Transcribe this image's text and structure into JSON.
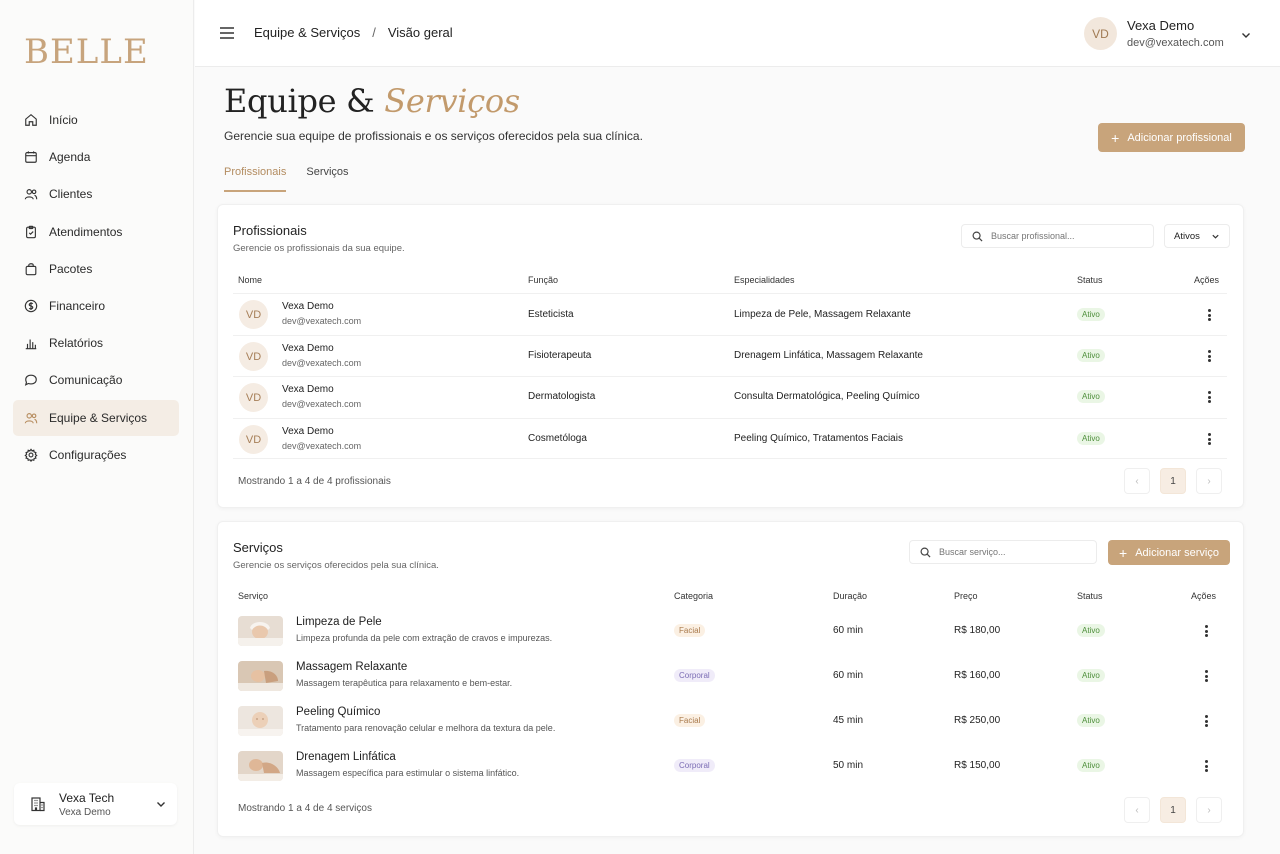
{
  "sidebar": {
    "logo": "BELLE",
    "items": [
      {
        "label": "Início",
        "icon": "home-icon"
      },
      {
        "label": "Agenda",
        "icon": "calendar-icon"
      },
      {
        "label": "Clientes",
        "icon": "users-icon"
      },
      {
        "label": "Atendimentos",
        "icon": "clipboard-icon"
      },
      {
        "label": "Pacotes",
        "icon": "bag-icon"
      },
      {
        "label": "Financeiro",
        "icon": "dollar-icon"
      },
      {
        "label": "Relatórios",
        "icon": "bar-chart-icon"
      },
      {
        "label": "Comunicação",
        "icon": "chat-icon"
      },
      {
        "label": "Equipe & Serviços",
        "icon": "team-icon",
        "active": true
      },
      {
        "label": "Configurações",
        "icon": "gear-icon"
      }
    ],
    "org": {
      "name": "Vexa Tech",
      "sub": "Vexa Demo"
    }
  },
  "header": {
    "crumb1": "Equipe & Serviços",
    "separator": "/",
    "crumb2": "Visão geral",
    "user": {
      "initials": "VD",
      "name": "Vexa Demo",
      "email": "dev@vexatech.com"
    }
  },
  "page": {
    "title_main": "Equipe &",
    "title_accent": "Serviços",
    "subtitle": "Gerencie sua equipe de profissionais e os serviços oferecidos pela sua clínica.",
    "add_professional": "Adicionar profissional",
    "tabs": [
      "Profissionais",
      "Serviços"
    ]
  },
  "professionals": {
    "title": "Profissionais",
    "subtitle": "Gerencie os profissionais da sua equipe.",
    "search_placeholder": "Buscar profissional...",
    "filter": "Ativos",
    "columns": {
      "name": "Nome",
      "role": "Função",
      "specialties": "Especialidades",
      "status": "Status",
      "actions": "Ações"
    },
    "rows": [
      {
        "initials": "VD",
        "name": "Vexa Demo",
        "email": "dev@vexatech.com",
        "role": "Esteticista",
        "specialties": "Limpeza de Pele, Massagem Relaxante",
        "status": "Ativo"
      },
      {
        "initials": "VD",
        "name": "Vexa Demo",
        "email": "dev@vexatech.com",
        "role": "Fisioterapeuta",
        "specialties": "Drenagem Linfática, Massagem Relaxante",
        "status": "Ativo"
      },
      {
        "initials": "VD",
        "name": "Vexa Demo",
        "email": "dev@vexatech.com",
        "role": "Dermatologista",
        "specialties": "Consulta Dermatológica, Peeling Químico",
        "status": "Ativo"
      },
      {
        "initials": "VD",
        "name": "Vexa Demo",
        "email": "dev@vexatech.com",
        "role": "Cosmetóloga",
        "specialties": "Peeling Químico, Tratamentos Faciais",
        "status": "Ativo"
      }
    ],
    "footer": "Mostrando 1 a 4 de 4 profissionais",
    "page": "1",
    "prev": "‹",
    "next": "›"
  },
  "services": {
    "title": "Serviços",
    "subtitle": "Gerencie os serviços oferecidos pela sua clínica.",
    "search_placeholder": "Buscar serviço...",
    "add": "Adicionar serviço",
    "columns": {
      "service": "Serviço",
      "category": "Categoria",
      "duration": "Duração",
      "price": "Preço",
      "status": "Status",
      "actions": "Ações"
    },
    "rows": [
      {
        "name": "Limpeza de Pele",
        "desc": "Limpeza profunda da pele com extração de cravos e impurezas.",
        "category": "Facial",
        "duration": "60 min",
        "price": "R$ 180,00",
        "status": "Ativo"
      },
      {
        "name": "Massagem Relaxante",
        "desc": "Massagem terapêutica para relaxamento e bem-estar.",
        "category": "Corporal",
        "duration": "60 min",
        "price": "R$ 160,00",
        "status": "Ativo"
      },
      {
        "name": "Peeling Químico",
        "desc": "Tratamento para renovação celular e melhora da textura da pele.",
        "category": "Facial",
        "duration": "45 min",
        "price": "R$ 250,00",
        "status": "Ativo"
      },
      {
        "name": "Drenagem Linfática",
        "desc": "Massagem específica para estimular o sistema linfático.",
        "category": "Corporal",
        "duration": "50 min",
        "price": "R$ 150,00",
        "status": "Ativo"
      }
    ],
    "footer": "Mostrando 1 a 4 de 4 serviços",
    "page": "1",
    "prev": "‹",
    "next": "›"
  },
  "colors": {
    "accent": "#c8a47b",
    "accent_text": "#c29a6c",
    "active_green": "#4d8e3a"
  }
}
